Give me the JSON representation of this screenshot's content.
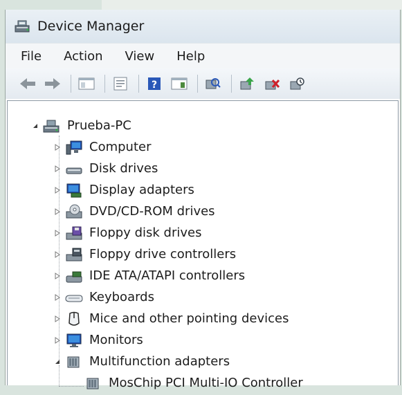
{
  "window": {
    "title": "Device Manager"
  },
  "menu": [
    "File",
    "Action",
    "View",
    "Help"
  ],
  "toolbar": {
    "buttons": [
      "back-icon",
      "forward-icon",
      "show-hide-console-tree-icon",
      "properties-icon",
      "help-icon",
      "action-pane-icon",
      "scan-hardware-icon",
      "update-driver-icon",
      "uninstall-icon",
      "disable-icon"
    ]
  },
  "tree": {
    "root": "Prueba-PC",
    "categories": [
      {
        "label": "Computer",
        "icon": "computer-icon",
        "expanded": false
      },
      {
        "label": "Disk drives",
        "icon": "disk-drive-icon",
        "expanded": false
      },
      {
        "label": "Display adapters",
        "icon": "display-adapter-icon",
        "expanded": false
      },
      {
        "label": "DVD/CD-ROM drives",
        "icon": "dvd-drive-icon",
        "expanded": false
      },
      {
        "label": "Floppy disk drives",
        "icon": "floppy-disk-icon",
        "expanded": false
      },
      {
        "label": "Floppy drive controllers",
        "icon": "floppy-controller-icon",
        "expanded": false
      },
      {
        "label": "IDE ATA/ATAPI controllers",
        "icon": "ide-controller-icon",
        "expanded": false
      },
      {
        "label": "Keyboards",
        "icon": "keyboard-icon",
        "expanded": false
      },
      {
        "label": "Mice and other pointing devices",
        "icon": "mouse-icon",
        "expanded": false
      },
      {
        "label": "Monitors",
        "icon": "monitor-icon",
        "expanded": false
      },
      {
        "label": "Multifunction adapters",
        "icon": "multifunction-icon",
        "expanded": true
      }
    ],
    "children": {
      "multifunction": [
        "MosChip PCI Multi-IO Controller"
      ]
    }
  }
}
